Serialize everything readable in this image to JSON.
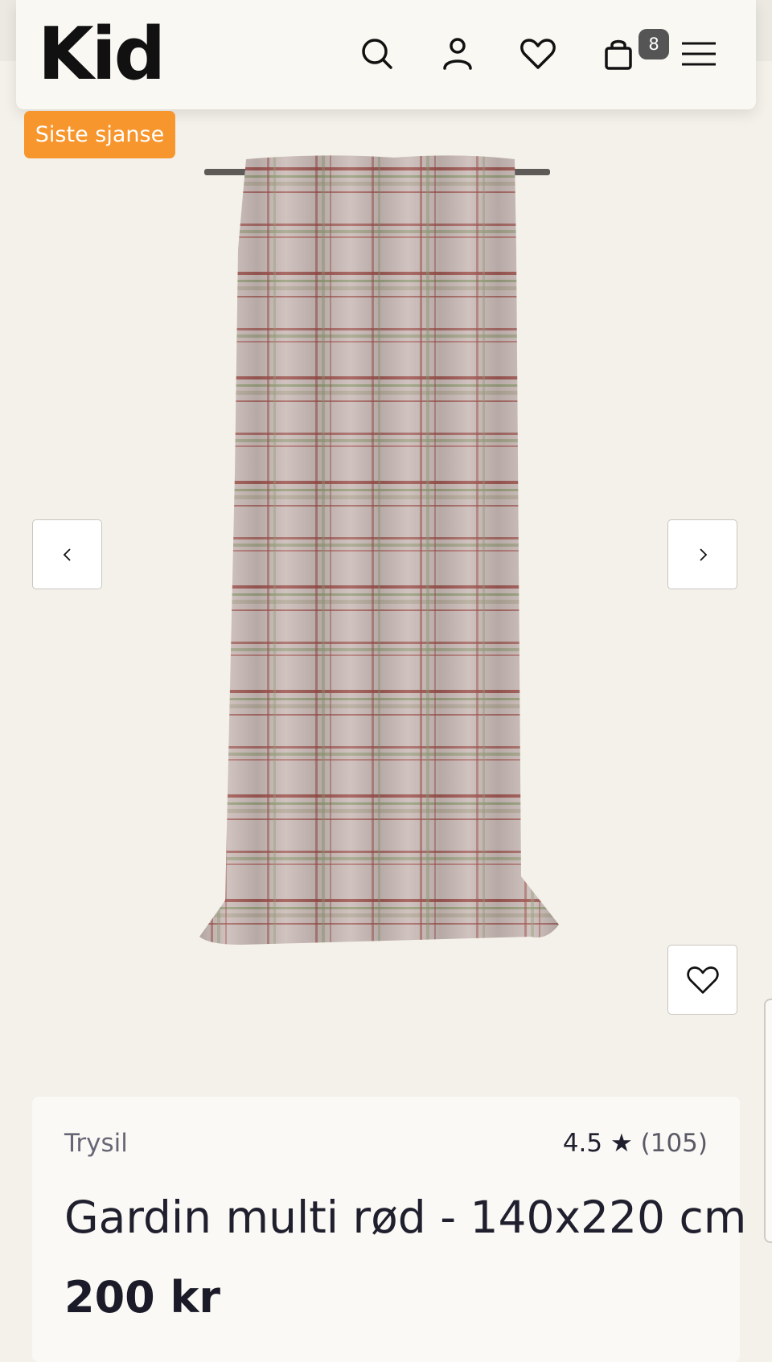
{
  "header": {
    "logo": "Kid",
    "icons": [
      "search-icon",
      "user-icon",
      "heart-icon",
      "cart-icon",
      "menu-icon"
    ],
    "cart_count": "8"
  },
  "product": {
    "badge": "Siste sjanse",
    "brand": "Trysil",
    "rating": "4.5",
    "rating_star": "★",
    "review_count": "(105)",
    "title": "Gardin multi rød - 140x220 cm",
    "price": "200 kr"
  },
  "colors": {
    "accent": "#f7962d",
    "background": "#f4f1ea",
    "curtain_base": "#c8b8b4",
    "curtain_red": "#9a4a45",
    "curtain_green": "#8f9a72"
  }
}
